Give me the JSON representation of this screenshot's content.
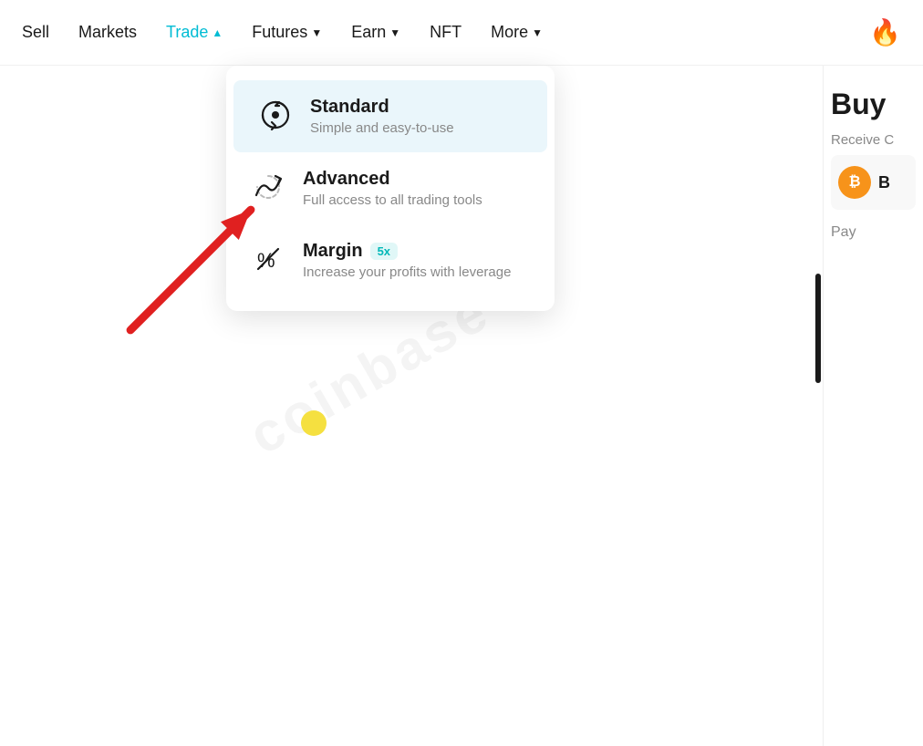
{
  "nav": {
    "items": [
      {
        "id": "sell",
        "label": "Sell",
        "active": false,
        "hasDropdown": false
      },
      {
        "id": "markets",
        "label": "Markets",
        "active": false,
        "hasDropdown": false
      },
      {
        "id": "trade",
        "label": "Trade",
        "active": true,
        "hasDropdown": true,
        "dropdownDir": "up"
      },
      {
        "id": "futures",
        "label": "Futures",
        "active": false,
        "hasDropdown": true
      },
      {
        "id": "earn",
        "label": "Earn",
        "active": false,
        "hasDropdown": true
      },
      {
        "id": "nft",
        "label": "NFT",
        "active": false,
        "hasDropdown": false
      },
      {
        "id": "more",
        "label": "More",
        "active": false,
        "hasDropdown": true
      }
    ],
    "fireIcon": "🔥"
  },
  "dropdown": {
    "items": [
      {
        "id": "standard",
        "title": "Standard",
        "subtitle": "Simple and easy-to-use",
        "badge": null,
        "highlighted": true
      },
      {
        "id": "advanced",
        "title": "Advanced",
        "subtitle": "Full access to all trading tools",
        "badge": null,
        "highlighted": false
      },
      {
        "id": "margin",
        "title": "Margin",
        "subtitle": "Increase your profits with leverage",
        "badge": "5x",
        "highlighted": false
      }
    ]
  },
  "rightPanel": {
    "buyLabel": "Buy",
    "receiveLabel": "Receive C",
    "btcSymbol": "₿",
    "btcLabel": "B",
    "payLabel": "Pay"
  },
  "colors": {
    "active": "#00bcd4",
    "arrowRed": "#e02020",
    "badgeBg": "#e0f7f7",
    "badgeText": "#00b8b8"
  }
}
